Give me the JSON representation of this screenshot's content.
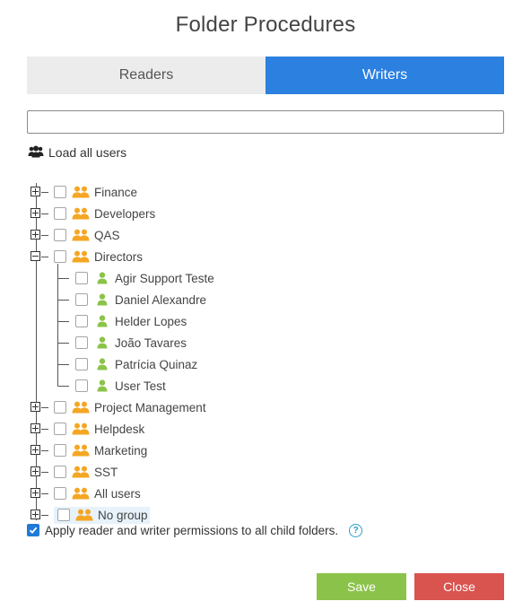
{
  "dialog": {
    "title": "Folder Procedures"
  },
  "tabs": {
    "readers": "Readers",
    "writers": "Writers",
    "active": "Writers"
  },
  "search": {
    "value": "",
    "placeholder": ""
  },
  "load_all": {
    "label": "Load all users",
    "icon": "users-icon"
  },
  "tree": {
    "groups_before": [
      {
        "label": "Finance",
        "icon": "group-icon",
        "expanded": false,
        "checked": false
      },
      {
        "label": "Developers",
        "icon": "group-icon",
        "expanded": false,
        "checked": false
      },
      {
        "label": "QAS",
        "icon": "group-icon",
        "expanded": false,
        "checked": false
      }
    ],
    "expanded_group": {
      "label": "Directors",
      "icon": "group-icon",
      "expanded": true,
      "checked": false,
      "users": [
        {
          "label": "Agir Support Teste",
          "icon": "user-icon",
          "checked": false
        },
        {
          "label": "Daniel Alexandre",
          "icon": "user-icon",
          "checked": false
        },
        {
          "label": "Helder Lopes",
          "icon": "user-icon",
          "checked": false
        },
        {
          "label": "João Tavares",
          "icon": "user-icon",
          "checked": false
        },
        {
          "label": "Patrícia Quinaz",
          "icon": "user-icon",
          "checked": false
        },
        {
          "label": "User Test",
          "icon": "user-icon",
          "checked": false
        }
      ]
    },
    "groups_after": [
      {
        "label": "Project Management",
        "icon": "group-icon",
        "expanded": false,
        "checked": false
      },
      {
        "label": "Helpdesk",
        "icon": "group-icon",
        "expanded": false,
        "checked": false
      },
      {
        "label": "Marketing",
        "icon": "group-icon",
        "expanded": false,
        "checked": false
      },
      {
        "label": "SST",
        "icon": "group-icon",
        "expanded": false,
        "checked": false
      },
      {
        "label": "All users",
        "icon": "group-icon",
        "expanded": false,
        "checked": false
      },
      {
        "label": "No group",
        "icon": "group-icon",
        "expanded": false,
        "checked": false,
        "highlighted": true
      }
    ]
  },
  "apply_children": {
    "label": "Apply reader and writer permissions to all child folders.",
    "checked": true,
    "help_icon": "help-icon"
  },
  "buttons": {
    "save": "Save",
    "close": "Close"
  },
  "colors": {
    "active_tab": "#2b80e0",
    "inactive_tab": "#ececec",
    "group_icon": "#f5a623",
    "user_icon": "#8bc34a",
    "save_button": "#8bc34a",
    "close_button": "#d9534f",
    "checkbox_checked": "#1f7ad8",
    "help": "#2aa0c8",
    "highlight": "#e7f2fb"
  }
}
